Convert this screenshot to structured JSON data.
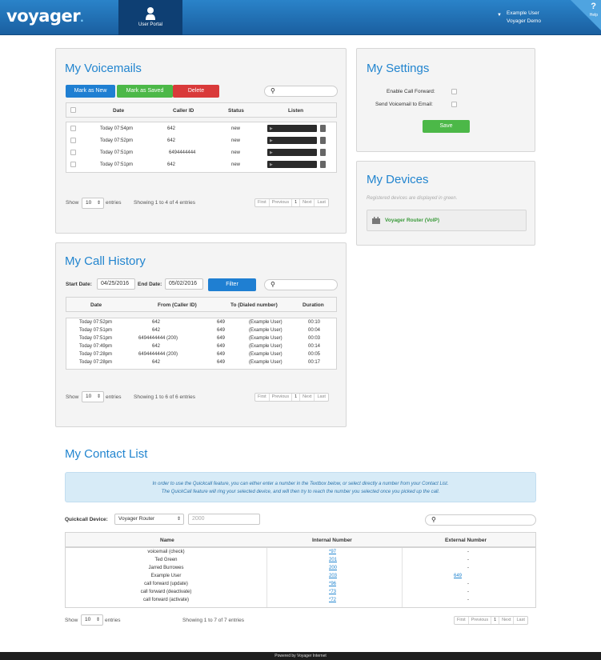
{
  "header": {
    "logo": "voyager",
    "logo_dot": ".",
    "nav_tab": "User Portal",
    "user_name": "Example User",
    "user_company": "Voyager Demo",
    "help_glyph": "?",
    "help_label": "Help"
  },
  "voicemails": {
    "title": "My Voicemails",
    "mark_new": "Mark as New",
    "mark_saved": "Mark as Saved",
    "delete": "Delete",
    "search_icon": "magnifier-icon",
    "columns": [
      "Date",
      "Caller ID",
      "Status",
      "Listen"
    ],
    "rows": [
      [
        "Today 07:54pm",
        "642",
        "new"
      ],
      [
        "Today 07:52pm",
        "642",
        "new"
      ],
      [
        "Today 07:51pm",
        "6494444444",
        "new"
      ],
      [
        "Today 07:51pm",
        "642",
        "new"
      ]
    ],
    "show": "Show",
    "entries_val": "10",
    "entries": "entries",
    "info": "Showing 1 to 4 of 4 entries"
  },
  "pager": {
    "first": "First",
    "prev": "Previous",
    "cur": "1",
    "next": "Next",
    "last": "Last"
  },
  "settings": {
    "title": "My Settings",
    "call_forward": "Enable Call Forward:",
    "vm_email": "Send Voicemail to Email:",
    "save": "Save"
  },
  "devices": {
    "title": "My Devices",
    "note": "Registered devices are displayed in green.",
    "device": "Voyager Router (VoIP)"
  },
  "history": {
    "title": "My Call History",
    "start_label": "Start Date:",
    "start": "04/25/2016",
    "end_label": "End Date:",
    "end": "05/02/2016",
    "filter": "Filter",
    "columns": [
      "Date",
      "From (Caller ID)",
      "To (Dialed number)",
      "Duration"
    ],
    "rows": [
      [
        "Today 07:52pm",
        "642",
        "649",
        "(Example User)",
        "00:10"
      ],
      [
        "Today 07:51pm",
        "642",
        "649",
        "(Example User)",
        "00:04"
      ],
      [
        "Today 07:51pm",
        "6494444444 (200)",
        "649",
        "(Example User)",
        "00:03"
      ],
      [
        "Today 07:49pm",
        "642",
        "649",
        "(Example User)",
        "00:14"
      ],
      [
        "Today 07:28pm",
        "6494444444 (200)",
        "649",
        "(Example User)",
        "00:05"
      ],
      [
        "Today 07:28pm",
        "642",
        "649",
        "(Example User)",
        "00:17"
      ]
    ],
    "show": "Show",
    "entries_val": "10",
    "entries": "entries",
    "info": "Showing 1 to 6 of 6 entries"
  },
  "contacts": {
    "title": "My Contact List",
    "notice1": "In order to use the Quickcall feature, you can either enter a number in the Textbox below, or select directly a number from your Contact List.",
    "notice2": "The QuickCall feature will ring your selected device, and will then try to reach the number you selected once you picked up the call.",
    "qc_label": "Quickcall Device:",
    "qc_device": "Voyager Router",
    "qc_number_placeholder": "2000",
    "columns": [
      "Name",
      "Internal Number",
      "External Number"
    ],
    "rows": [
      [
        "voicemail (check)",
        "*97",
        "-"
      ],
      [
        "Ted Green",
        "201",
        "-"
      ],
      [
        "Jarred Burrowes",
        "200",
        "-"
      ],
      [
        "Example User",
        "203",
        "649"
      ],
      [
        "call forward (update)",
        "*96",
        "-"
      ],
      [
        "call forward (deactivate)",
        "*73",
        "-"
      ],
      [
        "call forward (activate)",
        "*72",
        "-"
      ]
    ],
    "show": "Show",
    "entries_val": "10",
    "entries": "entries",
    "info": "Showing 1 to 7 of 7 entries"
  },
  "footer": "Powered by Voyager Internet"
}
